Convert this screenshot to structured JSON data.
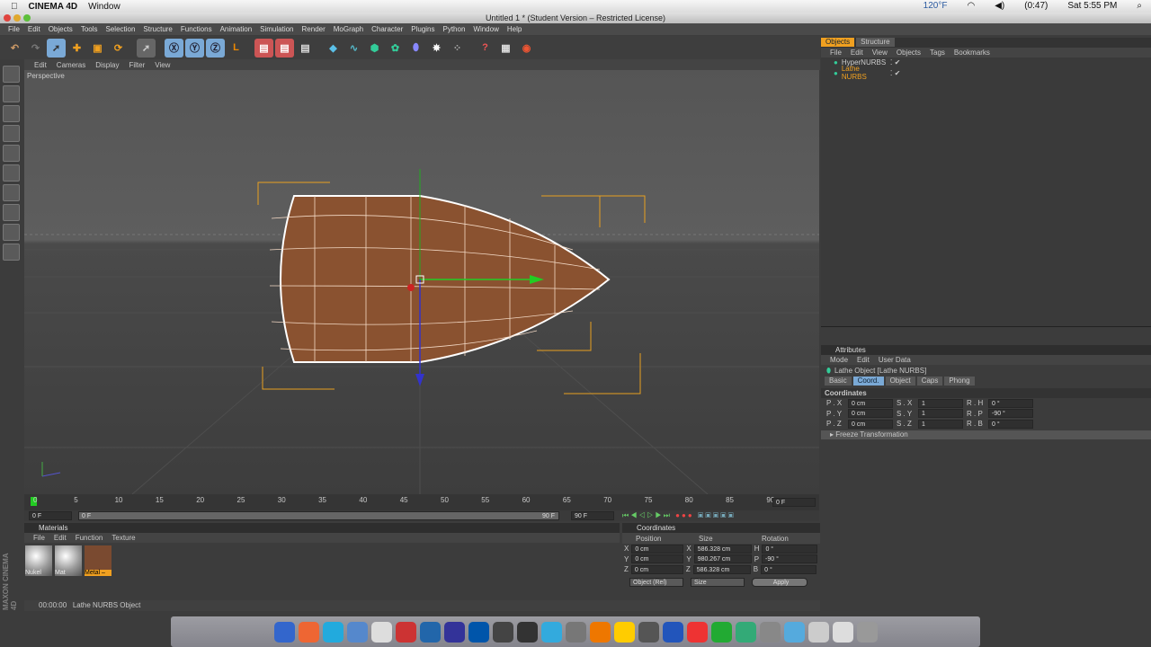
{
  "macbar": {
    "app": "CINEMA 4D",
    "menu": "Window",
    "temp": "120°F",
    "battery": "(0:47)",
    "clock": "Sat 5:55 PM"
  },
  "window": {
    "title": "Untitled 1 * (Student Version – Restricted License)"
  },
  "menu": [
    "File",
    "Edit",
    "Objects",
    "Tools",
    "Selection",
    "Structure",
    "Functions",
    "Animation",
    "Simulation",
    "Render",
    "MoGraph",
    "Character",
    "Plugins",
    "Python",
    "Window",
    "Help"
  ],
  "viewport": {
    "menu": [
      "Edit",
      "Cameras",
      "Display",
      "Filter",
      "View"
    ],
    "label": "Perspective"
  },
  "timeline": {
    "ticks": [
      "0",
      "5",
      "10",
      "15",
      "20",
      "25",
      "30",
      "35",
      "40",
      "45",
      "50",
      "55",
      "60",
      "65",
      "70",
      "75",
      "80",
      "85",
      "90"
    ],
    "current": "0 F",
    "start": "0 F",
    "slider": "0 F",
    "end_slider": "90 F",
    "end": "90 F",
    "right": "0 F"
  },
  "materials": {
    "title": "Materials",
    "menu": [
      "File",
      "Edit",
      "Function",
      "Texture"
    ],
    "items": [
      "Nukel",
      "Mat",
      "Metal –"
    ]
  },
  "coordinates": {
    "title": "Coordinates",
    "headers": [
      "Position",
      "Size",
      "Rotation"
    ],
    "rows": [
      {
        "a": "X",
        "p": "0 cm",
        "s": "X",
        "sv": "586.328 cm",
        "r": "H",
        "rv": "0 °"
      },
      {
        "a": "Y",
        "p": "0 cm",
        "s": "Y",
        "sv": "980.267 cm",
        "r": "P",
        "rv": "-90 °"
      },
      {
        "a": "Z",
        "p": "0 cm",
        "s": "Z",
        "sv": "586.328 cm",
        "r": "B",
        "rv": "0 °"
      }
    ],
    "mode": "Object (Rel)",
    "size_mode": "Size",
    "apply": "Apply"
  },
  "status": {
    "time": "00:00:00",
    "text": "Lathe NURBS Object"
  },
  "branding": "MAXON CINEMA 4D",
  "objects": {
    "tabs": [
      "Objects",
      "Structure"
    ],
    "menu": [
      "File",
      "Edit",
      "View",
      "Objects",
      "Tags",
      "Bookmarks"
    ],
    "items": [
      "HyperNURBS",
      "Lathe NURBS"
    ]
  },
  "attributes": {
    "title": "Attributes",
    "menu": [
      "Mode",
      "Edit",
      "User Data"
    ],
    "object": "Lathe Object [Lathe NURBS]",
    "tabs": [
      "Basic",
      "Coord.",
      "Object",
      "Caps",
      "Phong"
    ],
    "section": "Coordinates",
    "rows": [
      [
        "P . X",
        "0 cm",
        "S . X",
        "1",
        "R . H",
        "0 °"
      ],
      [
        "P . Y",
        "0 cm",
        "S . Y",
        "1",
        "R . P",
        "-90 °"
      ],
      [
        "P . Z",
        "0 cm",
        "S . Z",
        "1",
        "R . B",
        "0 °"
      ]
    ],
    "freeze": "Freeze Transformation"
  }
}
